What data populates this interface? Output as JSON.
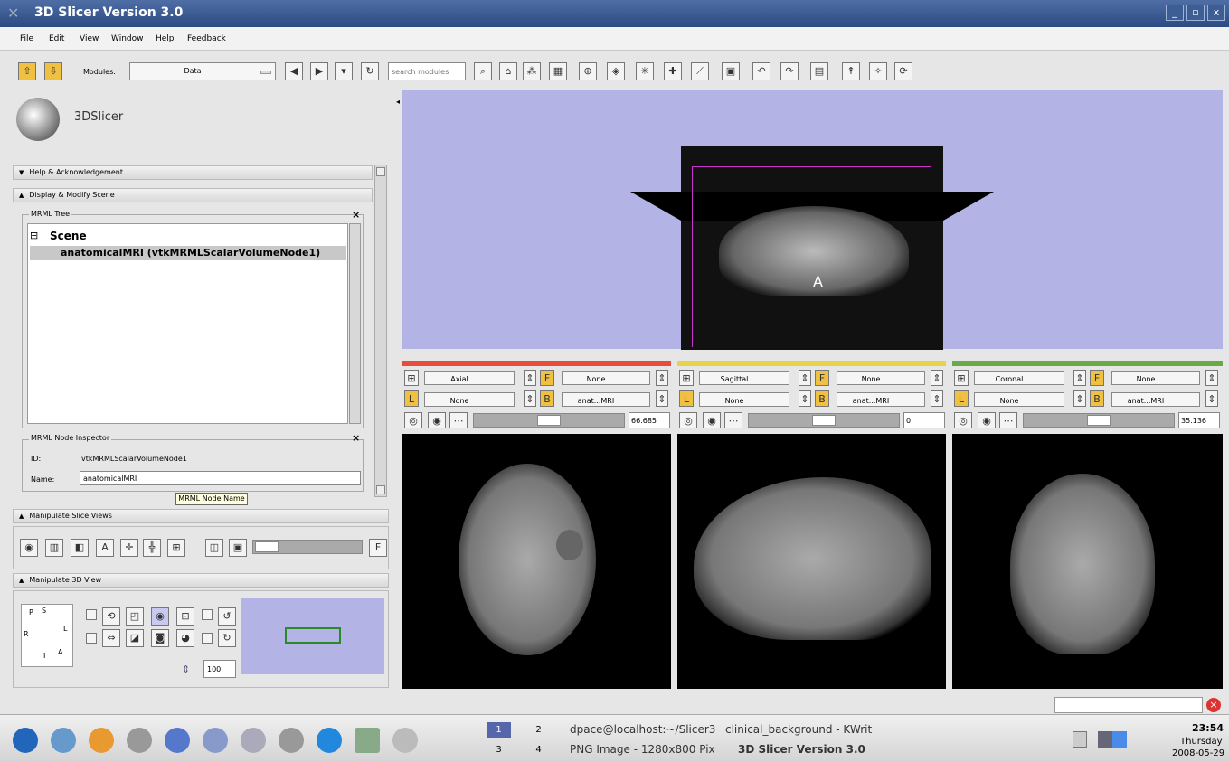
{
  "window": {
    "title": "3D Slicer Version 3.0",
    "min": "_",
    "max": "▫",
    "close": "x"
  },
  "menu": [
    "File",
    "Edit",
    "View",
    "Window",
    "Help",
    "Feedback"
  ],
  "toolbar": {
    "modules_label": "Modules:",
    "module_value": "Data",
    "search_placeholder": "search modules"
  },
  "logo_text": "3DSlicer",
  "sections": {
    "help": "Help & Acknowledgement",
    "display": "Display & Modify Scene",
    "slice": "Manipulate Slice Views",
    "view3d": "Manipulate 3D View"
  },
  "mrml_tree": {
    "title": "MRML Tree",
    "scene": "Scene",
    "node": "anatomicalMRI (vtkMRMLScalarVolumeNode1)"
  },
  "inspector": {
    "title": "MRML Node Inspector",
    "id_label": "ID:",
    "id_value": "vtkMRMLScalarVolumeNode1",
    "name_label": "Name:",
    "name_value": "anatomicalMRI",
    "tooltip": "MRML Node Name"
  },
  "view3d_zoom": "100",
  "slices": [
    {
      "orientation": "Axial",
      "fg": "None",
      "bg": "None",
      "label": "anat...MRI",
      "offset": "66.685",
      "color": "#e74c3c"
    },
    {
      "orientation": "Sagittal",
      "fg": "None",
      "bg": "None",
      "label": "anat...MRI",
      "offset": "0",
      "color": "#e8d24a"
    },
    {
      "orientation": "Coronal",
      "fg": "None",
      "bg": "None",
      "label": "anat...MRI",
      "offset": "35.136",
      "color": "#6aaa44"
    }
  ],
  "view3d_label": "A",
  "axes": {
    "P": "P",
    "S": "S",
    "R": "R",
    "L": "L",
    "I": "I",
    "A": "A"
  },
  "taskbar": {
    "desks": [
      "1",
      "2",
      "3",
      "4"
    ],
    "tasks": [
      "dpace@localhost:~/Slicer3",
      "clinical_background - KWrit",
      "PNG Image - 1280x800 Pix",
      "3D Slicer Version 3.0"
    ],
    "time": "23:54",
    "day": "Thursday",
    "date": "2008-05-29"
  }
}
